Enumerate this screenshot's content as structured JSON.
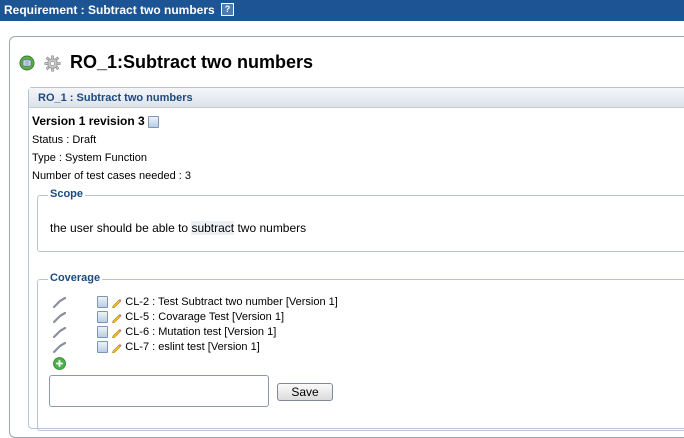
{
  "window": {
    "title": "Requirement : Subtract two numbers",
    "help_label": "?"
  },
  "heading": {
    "title": "RO_1:Subtract two numbers"
  },
  "panel": {
    "title": "RO_1 : Subtract two numbers",
    "version": "Version 1 revision 3",
    "status": "Status : Draft",
    "type": "Type : System Function",
    "test_cases": "Number of test cases needed : 3"
  },
  "scope": {
    "legend": "Scope",
    "text_before": "the user should be able to ",
    "text_highlight": "subtract",
    "text_after": " two numbers"
  },
  "coverage": {
    "legend": "Coverage",
    "items": [
      {
        "label": "CL-2 : Test Subtract two number [Version 1]"
      },
      {
        "label": "CL-5 : Covarage Test [Version 1]"
      },
      {
        "label": "CL-6 : Mutation test [Version 1]"
      },
      {
        "label": "CL-7 : eslint test [Version 1]"
      }
    ],
    "input_value": "",
    "save_label": "Save"
  },
  "colors": {
    "titlebar": "#1c5494",
    "accent_text": "#1c4a80"
  }
}
